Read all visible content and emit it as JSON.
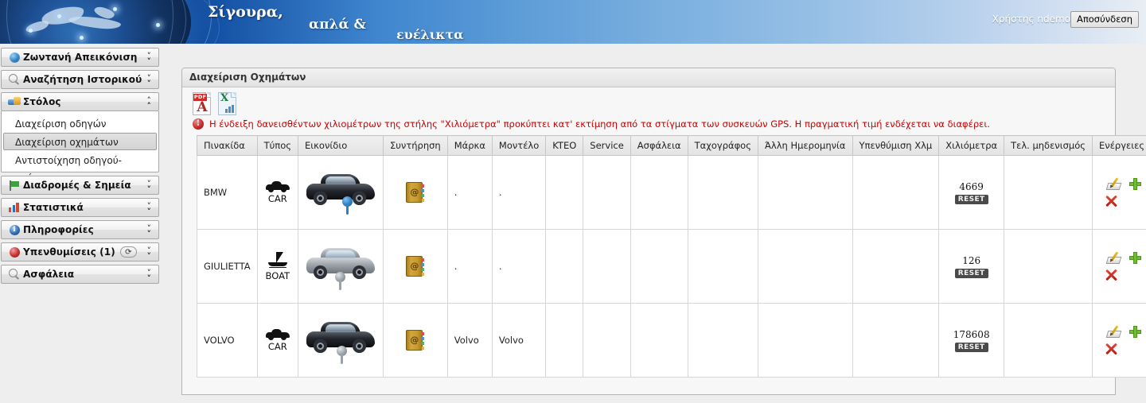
{
  "header": {
    "slogan_line1": "Σίγουρα,",
    "slogan_line2": "απλά  &",
    "slogan_line3": "ευέλικτα",
    "user_label": "Χρήστης ndemo",
    "logout_label": "Αποσύνδεση"
  },
  "sidebar": {
    "groups": [
      {
        "label": "Ζωντανή Απεικόνιση",
        "icon": "globe-icon",
        "expanded": false
      },
      {
        "label": "Αναζήτηση Ιστορικού",
        "icon": "magnifier-icon",
        "expanded": false
      },
      {
        "label": "Στόλος",
        "icon": "fleet-icon",
        "expanded": true
      },
      {
        "label": "Διαδρομές & Σημεία",
        "icon": "flag-icon",
        "expanded": false
      },
      {
        "label": "Στατιστικά",
        "icon": "bar-chart-icon",
        "expanded": false
      },
      {
        "label": "Πληροφορίες",
        "icon": "info-icon",
        "expanded": false
      },
      {
        "label": "Υπενθυμίσεις (1)",
        "icon": "alert-icon",
        "expanded": false,
        "refresh": "⟳"
      },
      {
        "label": "Ασφάλεια",
        "icon": "magnifier-icon",
        "expanded": false
      }
    ],
    "fleet_submenu": [
      {
        "label": "Διαχείριση οδηγών",
        "selected": false
      },
      {
        "label": "Διαχείριση οχημάτων",
        "selected": true
      },
      {
        "label": "Αντιστοίχηση οδηγού-οχήματος",
        "selected": false
      }
    ]
  },
  "panel": {
    "title": "Διαχείριση Οχημάτων",
    "toolbar": {
      "pdf_label": "PDF",
      "pdf_glyph": "A",
      "excel_glyph": "X"
    },
    "notice": {
      "icon_glyph": "!",
      "text": "Η ένδειξη δανεισθέντων χιλιομέτρων της στήλης \"Χιλιόμετρα\" προκύπτει κατ' εκτίμηση από τα στίγματα των συσκευών GPS. Η πραγματική τιμή ενδέχεται να διαφέρει.",
      "color": "#cc0000"
    },
    "table": {
      "columns": [
        "Πινακίδα",
        "Τύπος",
        "Εικονίδιο",
        "Συντήρηση",
        "Μάρκα",
        "Μοντέλο",
        "KTEO",
        "Service",
        "Ασφάλεια",
        "Ταχογράφος",
        "Άλλη Ημερομηνία",
        "Υπενθύμιση Χλμ",
        "Χιλιόμετρα",
        "Τελ. μηδενισμός",
        "Ενέργειες"
      ],
      "reset_label": "RESET",
      "rows": [
        {
          "plate": "BMW",
          "type": "CAR",
          "type_icon": "car-icon",
          "photo": "dark-sedan-photo",
          "pin": "blue-pin",
          "maintenance_icon": "address-book-icon",
          "brand": ".",
          "model": ".",
          "kteo": "",
          "service": "",
          "insurance": "",
          "tachograph": "",
          "other_date": "",
          "km_reminder": "",
          "kilometers": "4669",
          "last_reset": "",
          "actions": [
            "edit-icon",
            "add-icon",
            "delete-icon"
          ]
        },
        {
          "plate": "GIULIETTA",
          "type": "BOAT",
          "type_icon": "boat-icon",
          "photo": "grey-hatchback-photo",
          "pin": "grey-pin",
          "maintenance_icon": "address-book-icon",
          "brand": ".",
          "model": ".",
          "kteo": "",
          "service": "",
          "insurance": "",
          "tachograph": "",
          "other_date": "",
          "km_reminder": "",
          "kilometers": "126",
          "last_reset": "",
          "actions": [
            "edit-icon",
            "add-icon",
            "delete-icon"
          ]
        },
        {
          "plate": "VOLVO",
          "type": "CAR",
          "type_icon": "car-icon",
          "photo": "dark-sedan-photo",
          "pin": "grey-pin",
          "maintenance_icon": "address-book-icon",
          "brand": "Volvo",
          "model": "Volvo",
          "kteo": "",
          "service": "",
          "insurance": "",
          "tachograph": "",
          "other_date": "",
          "km_reminder": "",
          "kilometers": "178608",
          "last_reset": "",
          "actions": [
            "edit-icon",
            "add-icon",
            "delete-icon"
          ]
        }
      ]
    }
  }
}
